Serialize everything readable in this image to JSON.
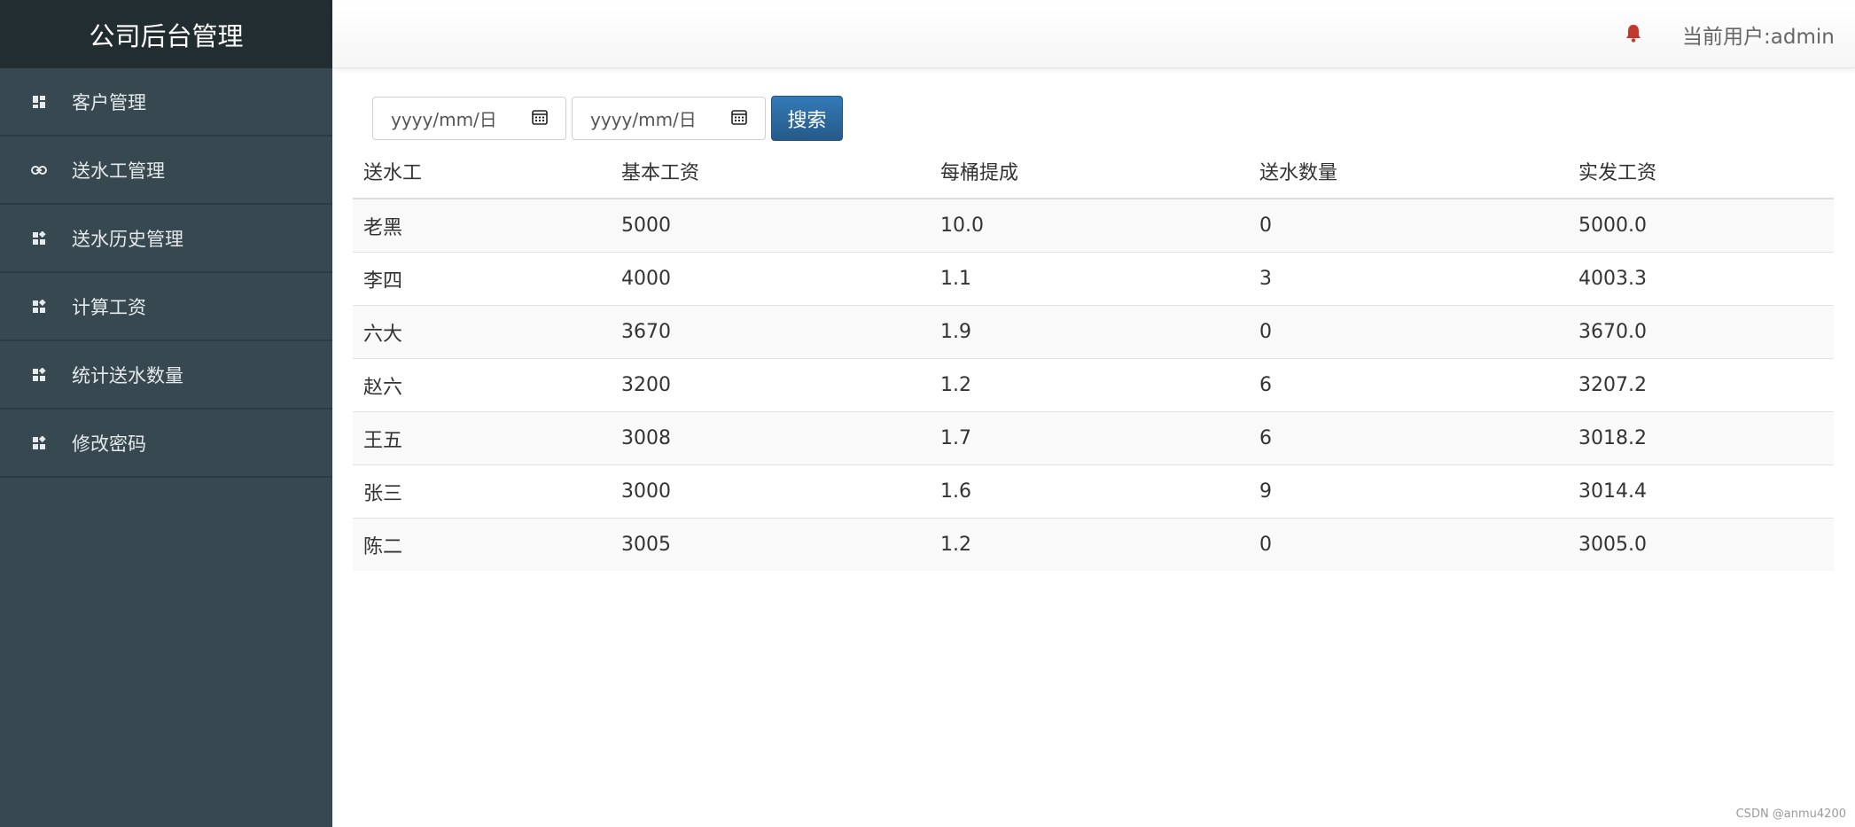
{
  "sidebar": {
    "brand": "公司后台管理",
    "items": [
      {
        "label": "客户管理",
        "icon": "dashboard-icon"
      },
      {
        "label": "送水工管理",
        "icon": "link-icon"
      },
      {
        "label": "送水历史管理",
        "icon": "widgets-icon"
      },
      {
        "label": "计算工资",
        "icon": "widgets-icon"
      },
      {
        "label": "统计送水数量",
        "icon": "widgets-icon"
      },
      {
        "label": "修改密码",
        "icon": "widgets-icon"
      }
    ]
  },
  "header": {
    "bell_icon": "bell-icon",
    "user_text": "当前用户:admin"
  },
  "search": {
    "start_date_placeholder": "yyyy/mm/日",
    "end_date_placeholder": "yyyy/mm/日",
    "button_label": "搜索"
  },
  "table": {
    "headers": [
      "送水工",
      "基本工资",
      "每桶提成",
      "送水数量",
      "实发工资"
    ],
    "rows": [
      [
        "老黑",
        "5000",
        "10.0",
        "0",
        "5000.0"
      ],
      [
        "李四",
        "4000",
        "1.1",
        "3",
        "4003.3"
      ],
      [
        "六大",
        "3670",
        "1.9",
        "0",
        "3670.0"
      ],
      [
        "赵六",
        "3200",
        "1.2",
        "6",
        "3207.2"
      ],
      [
        "王五",
        "3008",
        "1.7",
        "6",
        "3018.2"
      ],
      [
        "张三",
        "3000",
        "1.6",
        "9",
        "3014.4"
      ],
      [
        "陈二",
        "3005",
        "1.2",
        "0",
        "3005.0"
      ]
    ]
  },
  "watermark": "CSDN @anmu4200",
  "colors": {
    "sidebar_bg": "#374850",
    "brand_bg": "#222d32",
    "button_bg": "#2e6da4",
    "bell": "#c0392b"
  }
}
